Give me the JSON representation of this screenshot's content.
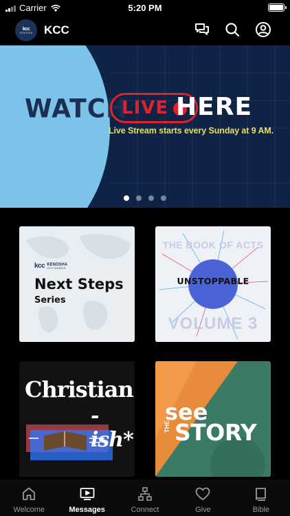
{
  "status_bar": {
    "carrier": "Carrier",
    "time": "5:20 PM"
  },
  "header": {
    "logo_mark": "kcc",
    "logo_sub": "KENOSHA",
    "title": "KCC",
    "icons": [
      "chat-icon",
      "search-icon",
      "profile-icon"
    ]
  },
  "hero": {
    "watch": "WATCH",
    "live": "LIVE",
    "here": "HERE",
    "subtitle": "Live Stream starts every Sunday at 9 AM.",
    "slide_count": 4,
    "active_slide": 1,
    "colors": {
      "navy": "#0f2346",
      "sky": "#7cc3ea",
      "live_red": "#e2212c",
      "subtitle_yellow": "#e6e052"
    }
  },
  "series": [
    {
      "logo_mark": "kcc",
      "logo_name": "KENOSHA",
      "logo_tag": "CITY CHURCH",
      "title": "Next Steps",
      "subtitle": "Series"
    },
    {
      "top": "THE BOOK OF ACTS",
      "title": "UNSTOPPABLE",
      "bottom": "VOLUME 3"
    },
    {
      "title": "Christian",
      "suffix": "-ish*"
    },
    {
      "line1": "see",
      "the": "THE",
      "line2": "STORY"
    }
  ],
  "tabs": [
    {
      "label": "Welcome",
      "icon": "home-icon",
      "active": false
    },
    {
      "label": "Messages",
      "icon": "tv-icon",
      "active": true
    },
    {
      "label": "Connect",
      "icon": "network-icon",
      "active": false
    },
    {
      "label": "Give",
      "icon": "heart-icon",
      "active": false
    },
    {
      "label": "Bible",
      "icon": "book-icon",
      "active": false
    }
  ]
}
